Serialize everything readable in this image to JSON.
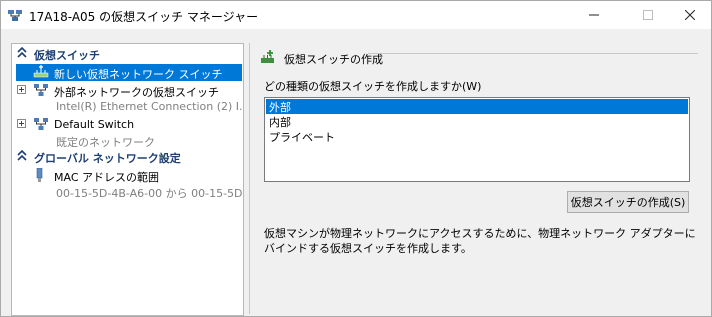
{
  "window": {
    "title": "17A18-A05 の仮想スイッチ マネージャー",
    "controls": {
      "minimize": "—",
      "maximize": "☐",
      "close": "✕"
    }
  },
  "left_pane": {
    "sections": [
      {
        "title": "仮想スイッチ",
        "items": [
          {
            "label": "新しい仮想ネットワーク スイッチ",
            "selected": true,
            "expandable": false,
            "icon": "new-switch-icon"
          },
          {
            "label": "外部ネットワークの仮想スイッチ",
            "sublabel": "Intel(R) Ethernet Connection (2) I...",
            "expandable": true,
            "icon": "network-switch-icon"
          },
          {
            "label": "Default Switch",
            "sublabel": "既定のネットワーク",
            "expandable": true,
            "icon": "network-switch-icon"
          }
        ]
      },
      {
        "title": "グローバル ネットワーク設定",
        "items": [
          {
            "label": "MAC アドレスの範囲",
            "sublabel": "00-15-5D-4B-A6-00 から 00-15-5D-...",
            "icon": "network-adapter-icon"
          }
        ]
      }
    ]
  },
  "right_pane": {
    "group_title": "仮想スイッチの作成",
    "prompt": "どの種類の仮想スイッチを作成しますか(W)",
    "switch_types": [
      {
        "label": "外部",
        "selected": true
      },
      {
        "label": "内部",
        "selected": false
      },
      {
        "label": "プライベート",
        "selected": false
      }
    ],
    "create_button": "仮想スイッチの作成(S)",
    "description": "仮想マシンが物理ネットワークにアクセスするために、物理ネットワーク アダプターにバインドする仮想スイッチを作成します。"
  },
  "colors": {
    "selection": "#0078d7",
    "section_header": "#1c3e73",
    "secondary_text": "#808080"
  }
}
